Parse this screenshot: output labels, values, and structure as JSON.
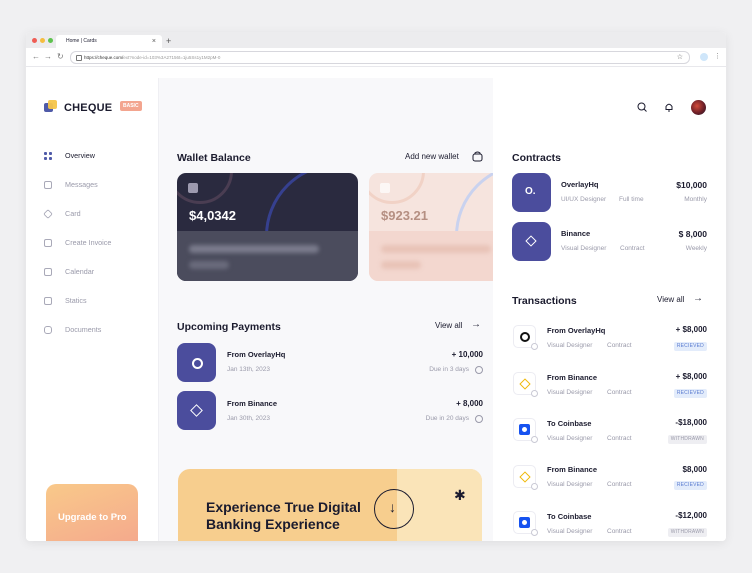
{
  "browser": {
    "tab_title": "Home | Cards",
    "tab_close": "×",
    "new_tab": "+",
    "url_host": "https://cheque.com/",
    "url_rest": "ext?node-id=103%3A27156t=1ju5Ss1y1M2pM-0"
  },
  "sidebar": {
    "logo": "CHEQUE",
    "plan_badge": "BASIC",
    "items": [
      {
        "label": "Overview"
      },
      {
        "label": "Messages"
      },
      {
        "label": "Card"
      },
      {
        "label": "Create Invoice"
      },
      {
        "label": "Calendar"
      },
      {
        "label": "Statics"
      },
      {
        "label": "Documents"
      }
    ],
    "upgrade_label": "Upgrade to Pro"
  },
  "wallet": {
    "title": "Wallet Balance",
    "add_label": "Add new wallet",
    "cards": [
      {
        "amount": "$4,0342",
        "theme": "#2a2a3f"
      },
      {
        "amount": "$923.21",
        "theme": "#f6e4de"
      }
    ]
  },
  "payments": {
    "title": "Upcoming Payments",
    "view_all": "View all",
    "items": [
      {
        "name": "From OverlayHq",
        "date": "Jan 13th, 2023",
        "amount": "+ 10,000",
        "due": "Due in 3 days"
      },
      {
        "name": "From Binance",
        "date": "Jan 30th, 2023",
        "amount": "+ 8,000",
        "due": "Due in 20 days"
      }
    ]
  },
  "promo": {
    "title": "Experience True Digital Banking Experience",
    "badge_icon": "arrow-down-icon"
  },
  "contracts": {
    "title": "Contracts",
    "items": [
      {
        "name": "OverlayHq",
        "role": "UI/UX Designer",
        "type": "Full time",
        "amount": "$10,000",
        "period": "Monthly"
      },
      {
        "name": "Binance",
        "role": "Visual Designer",
        "type": "Contract",
        "amount": "$ 8,000",
        "period": "Weekly"
      }
    ]
  },
  "transactions": {
    "title": "Transactions",
    "view_all": "View all",
    "items": [
      {
        "name": "From OverlayHq",
        "role": "Visual Designer",
        "type": "Contract",
        "amount": "+ $8,000",
        "status": "RECIEVED",
        "icon": "overlayhq-icon"
      },
      {
        "name": "From Binance",
        "role": "Visual Designer",
        "type": "Contract",
        "amount": "+ $8,000",
        "status": "RECIEVED",
        "icon": "binance-icon"
      },
      {
        "name": "To Coinbase",
        "role": "Visual Designer",
        "type": "Contract",
        "amount": "-$18,000",
        "status": "WITHDRAWN",
        "icon": "coinbase-icon"
      },
      {
        "name": "From Binance",
        "role": "Visual Designer",
        "type": "Contract",
        "amount": "$8,000",
        "status": "RECIEVED",
        "icon": "binance-icon"
      },
      {
        "name": "To Coinbase",
        "role": "Visual Designer",
        "type": "Contract",
        "amount": "-$12,000",
        "status": "WITHDRAWN",
        "icon": "coinbase-icon"
      }
    ]
  },
  "colors": {
    "accent": "#4b4d9d",
    "promo": "#f7ce8e",
    "upgrade": "#f4a58d",
    "received": "#5a7bd0"
  }
}
